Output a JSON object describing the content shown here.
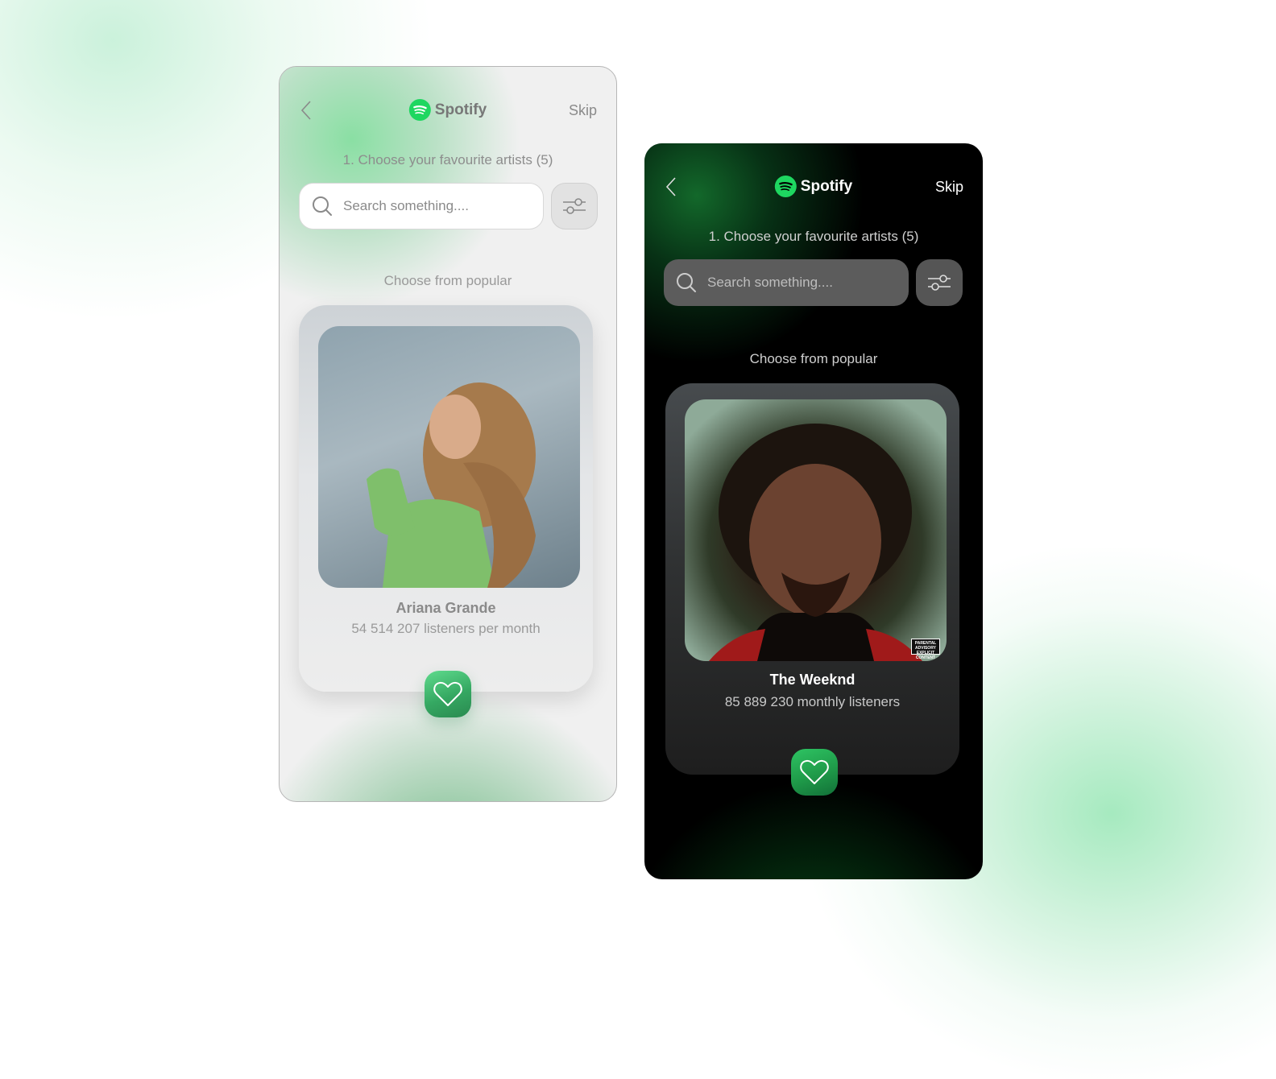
{
  "light_screen": {
    "theme": "light",
    "brand": "Spotify",
    "skip_label": "Skip",
    "step_title": "1. Choose your favourite artists (5)",
    "search_placeholder": "Search something....",
    "section_label": "Choose from popular",
    "artist": {
      "name": "Ariana Grande",
      "listeners": "54 514 207 listeners per month"
    },
    "icons": {
      "back": "chevron-left-icon",
      "logo": "spotify-logo-icon",
      "search": "search-icon",
      "filter": "sliders-icon",
      "like": "heart-icon"
    }
  },
  "dark_screen": {
    "theme": "dark",
    "brand": "Spotify",
    "skip_label": "Skip",
    "step_title": "1. Choose your favourite artists (5)",
    "search_placeholder": "Search something....",
    "section_label": "Choose from popular",
    "artist": {
      "name": "The Weeknd",
      "listeners": "85 889 230 monthly listeners",
      "advisory_label": "PARENTAL ADVISORY EXPLICIT CONTENT"
    },
    "icons": {
      "back": "chevron-left-icon",
      "logo": "spotify-logo-icon",
      "search": "search-icon",
      "filter": "sliders-icon",
      "like": "heart-icon"
    }
  },
  "colors": {
    "spotify_green": "#1ed760",
    "like_light": "#35a862",
    "like_dark": "#1f9a49"
  }
}
